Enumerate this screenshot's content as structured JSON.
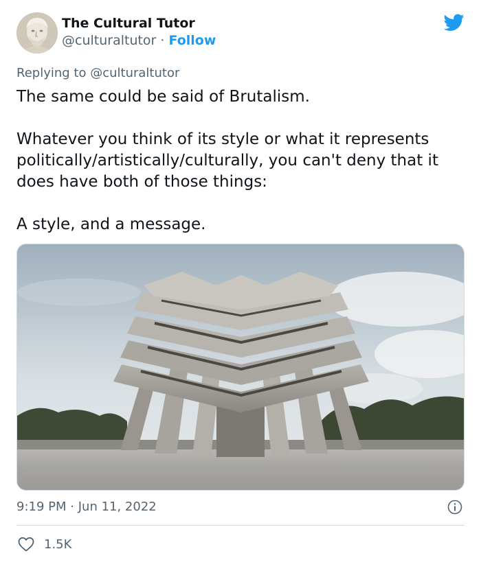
{
  "author": {
    "display_name": "The Cultural Tutor",
    "handle": "@culturaltutor",
    "separator": "·",
    "follow_label": "Follow",
    "avatar_icon": "classical-bust-avatar",
    "platform_icon": "twitter-bird-icon"
  },
  "reply": {
    "prefix": "Replying to",
    "mention": "@culturaltutor"
  },
  "tweet": {
    "paragraphs": [
      "The same could be said of Brutalism.",
      "Whatever you think of its style or what it represents politically/artistically/culturally, you can't deny that it does have both of those things:",
      "A style, and a message."
    ]
  },
  "media": {
    "icon": "brutalist-building-photo"
  },
  "meta": {
    "time": "9:19 PM",
    "separator": "·",
    "date": "Jun 11, 2022",
    "info_icon": "info-icon"
  },
  "engagement": {
    "like_icon": "heart-icon",
    "like_count": "1.5K"
  },
  "colors": {
    "accent": "#1d9bf0",
    "text": "#0f1419",
    "secondary": "#536471",
    "border": "#cfd9de"
  }
}
